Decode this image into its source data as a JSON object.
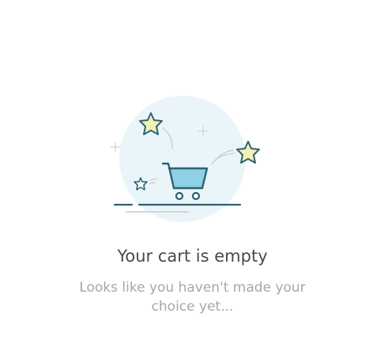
{
  "empty_state": {
    "title": "Your cart is empty",
    "message": "Looks like you haven't made your choice yet..."
  },
  "colors": {
    "circle": "#eaf5f9",
    "cart_fill": "#8ed0e4",
    "line": "#2f6173",
    "star_fill": "#f2f1b3",
    "title": "#4a4a4a",
    "message": "#a7a7a7"
  },
  "icons": [
    "shopping-cart-icon",
    "star-icon",
    "plus-icon"
  ]
}
